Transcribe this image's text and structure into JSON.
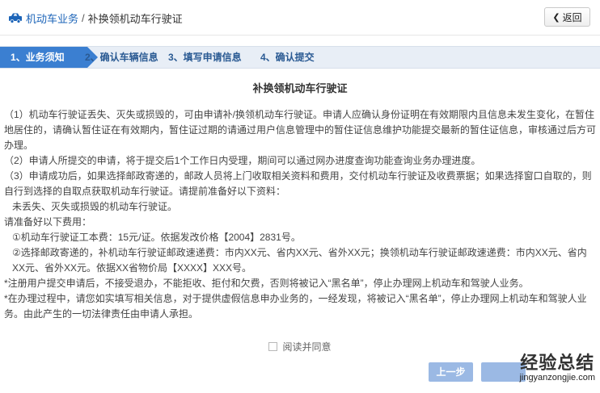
{
  "header": {
    "section_link": "机动车业务",
    "separator": "/",
    "current": "补换领机动车行驶证",
    "back_label": "返回",
    "back_icon": "chevron-left-icon"
  },
  "steps": [
    {
      "label": "1、业务须知",
      "active": true
    },
    {
      "label": "2、确认车辆信息",
      "active": false
    },
    {
      "label": "3、填写申请信息",
      "active": false
    },
    {
      "label": "4、确认提交",
      "active": false
    }
  ],
  "main": {
    "title": "补换领机动车行驶证",
    "paragraphs": [
      "（1）机动车行驶证丢失、灭失或损毁的，可由申请补/换领机动车行驶证。申请人应确认身份证明在有效期限内且信息未发生变化，在暂住地居住的，请确认暂住证在有效期内，暂住证过期的请通过用户信息管理中的暂住证信息维护功能提交最新的暂住证信息，审核通过后方可办理。",
      "（2）申请人所提交的申请，将于提交后1个工作日内受理，期间可以通过网办进度查询功能查询业务办理进度。",
      "（3）申请成功后，如果选择邮政寄递的，邮政人员将上门收取相关资料和费用，交付机动车行驶证及收费票据；如果选择窗口自取的，则自行到选择的自取点获取机动车行驶证。请提前准备好以下资料：",
      "未丢失、灭失或损毁的机动车行驶证。",
      "请准备好以下费用：",
      "①机动车行驶证工本费：15元/证。依据发改价格【2004】2831号。",
      "②选择邮政寄递的，补机动车行驶证邮政速递费：市内XX元、省内XX元、省外XX元；换领机动车行驶证邮政速递费：市内XX元、省内XX元、省外XX元。依据XX省物价局【XXXX】XXX号。",
      "*注册用户提交申请后，不接受退办，不能拒收、拒付和欠费，否则将被记入“黑名单”，停止办理网上机动车和驾驶人业务。",
      "*在办理过程中，请您如实填写相关信息，对于提供虚假信息申办业务的，一经发现，将被记入“黑名单”，停止办理网上机动车和驾驶人业务。由此产生的一切法律责任由申请人承担。"
    ]
  },
  "agree": {
    "label": "阅读并同意",
    "checked": false
  },
  "buttons": {
    "prev": "上一步",
    "next": ""
  },
  "watermark": {
    "cn": "经验总结",
    "en": "jingyanzongjie.com"
  },
  "colors": {
    "accent": "#3b7fd1",
    "step_bar": "#e8eef6",
    "link": "#1c64b8",
    "button_disabled": "#9bb9e4"
  }
}
